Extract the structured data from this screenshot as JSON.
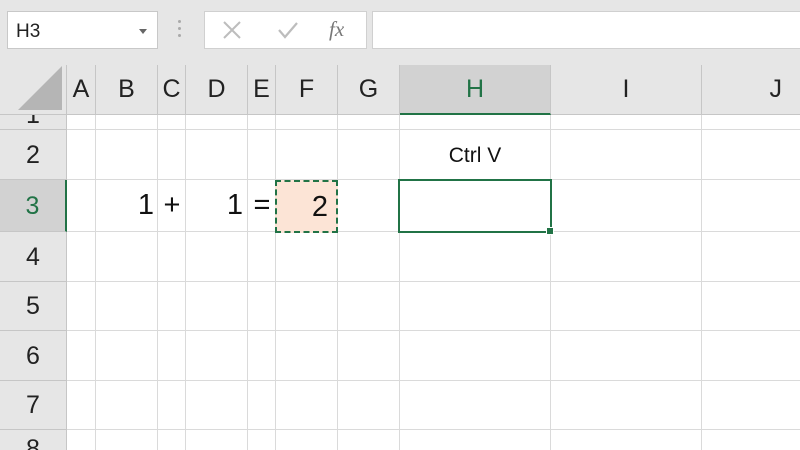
{
  "name_box": {
    "value": "H3"
  },
  "formula_bar": {
    "cancel_icon": "x-icon",
    "enter_icon": "check-icon",
    "function_label": "fx",
    "value": ""
  },
  "columns": [
    {
      "label": "A"
    },
    {
      "label": "B"
    },
    {
      "label": "C"
    },
    {
      "label": "D"
    },
    {
      "label": "E"
    },
    {
      "label": "F"
    },
    {
      "label": "G"
    },
    {
      "label": "H"
    },
    {
      "label": "I"
    },
    {
      "label": "J"
    }
  ],
  "rows": [
    {
      "label": "1"
    },
    {
      "label": "2"
    },
    {
      "label": "3"
    },
    {
      "label": "4"
    },
    {
      "label": "5"
    },
    {
      "label": "6"
    },
    {
      "label": "7"
    },
    {
      "label": "8"
    }
  ],
  "cells": {
    "B3": "1",
    "C3": "+",
    "D3": "1",
    "E3": "=",
    "F3": "2",
    "H2": "Ctrl V",
    "H3": ""
  },
  "selection": {
    "active": "H3",
    "copied": "F3"
  },
  "colors": {
    "accent": "#217346",
    "copy_fill": "#fce4d6",
    "header_bg": "#e6e6e6",
    "selected_header_bg": "#d2d2d2"
  }
}
